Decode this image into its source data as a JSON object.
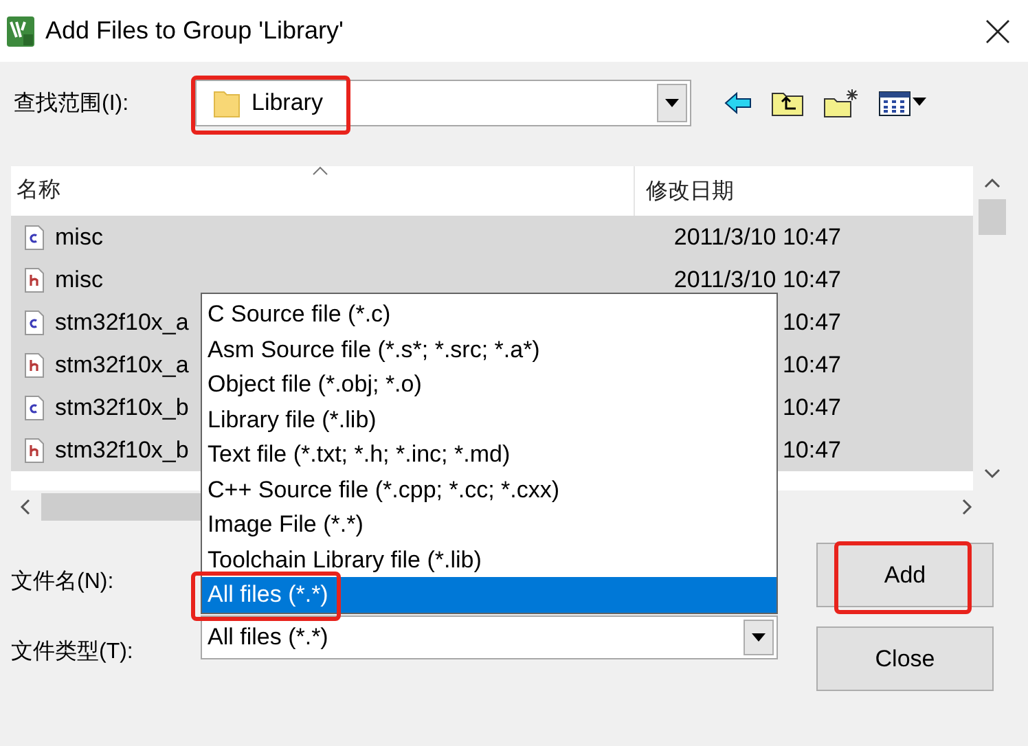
{
  "window": {
    "title": "Add Files to Group 'Library'"
  },
  "look_in": {
    "label": "查找范围(I):",
    "value": "Library"
  },
  "file_list": {
    "columns": [
      "名称",
      "修改日期"
    ],
    "rows": [
      {
        "kind": "c",
        "name": "misc",
        "date": "2011/3/10 10:47",
        "selected": true
      },
      {
        "kind": "h",
        "name": "misc",
        "date": "2011/3/10 10:47",
        "selected": true
      },
      {
        "kind": "c",
        "name": "stm32f10x_a",
        "date": "10:47",
        "selected": true
      },
      {
        "kind": "h",
        "name": "stm32f10x_a",
        "date": "10:47",
        "selected": true
      },
      {
        "kind": "c",
        "name": "stm32f10x_b",
        "date": "10:47",
        "selected": true
      },
      {
        "kind": "h",
        "name": "stm32f10x_b",
        "date": "10:47",
        "selected": true
      }
    ]
  },
  "file_name": {
    "label": "文件名(N):"
  },
  "file_type": {
    "label": "文件类型(T):",
    "value": "All files (*.*)",
    "options": [
      {
        "label": "C Source file (*.c)",
        "selected": false
      },
      {
        "label": "Asm Source file (*.s*; *.src; *.a*)",
        "selected": false
      },
      {
        "label": "Object file (*.obj; *.o)",
        "selected": false
      },
      {
        "label": "Library file (*.lib)",
        "selected": false
      },
      {
        "label": "Text file (*.txt; *.h; *.inc; *.md)",
        "selected": false
      },
      {
        "label": "C++ Source file (*.cpp; *.cc; *.cxx)",
        "selected": false
      },
      {
        "label": "Image File (*.*)",
        "selected": false
      },
      {
        "label": "Toolchain Library file (*.lib)",
        "selected": false
      },
      {
        "label": "All files (*.*)",
        "selected": true
      }
    ]
  },
  "buttons": [
    "Add",
    "Close"
  ]
}
